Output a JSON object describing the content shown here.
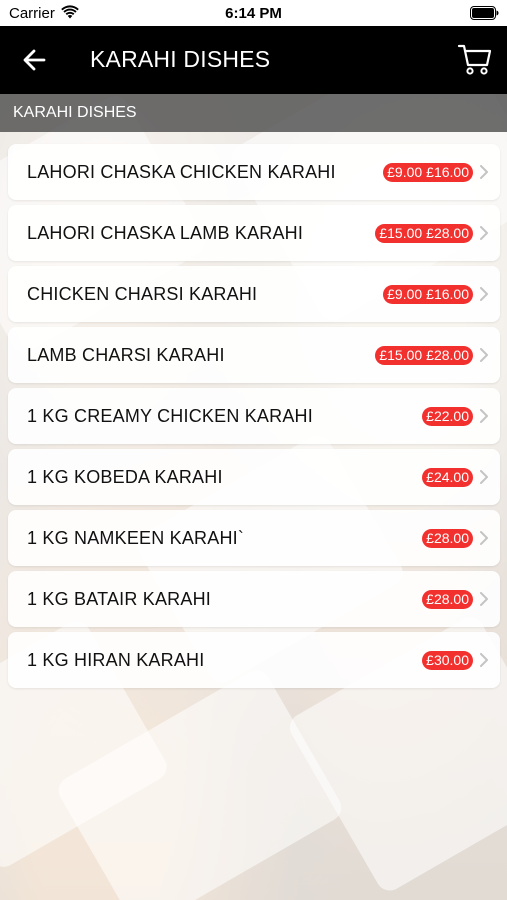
{
  "status_bar": {
    "carrier": "Carrier",
    "time": "6:14 PM"
  },
  "nav": {
    "title": "KARAHI DISHES"
  },
  "section": {
    "header": "KARAHI DISHES"
  },
  "items": [
    {
      "name": "LAHORI CHASKA CHICKEN KARAHI",
      "prices": [
        "£9.00",
        "£16.00"
      ]
    },
    {
      "name": "LAHORI CHASKA LAMB KARAHI",
      "prices": [
        "£15.00",
        "£28.00"
      ]
    },
    {
      "name": "CHICKEN CHARSI KARAHI",
      "prices": [
        "£9.00",
        "£16.00"
      ]
    },
    {
      "name": "LAMB CHARSI KARAHI",
      "prices": [
        "£15.00",
        "£28.00"
      ]
    },
    {
      "name": "1 KG CREAMY CHICKEN KARAHI",
      "prices": [
        "£22.00"
      ]
    },
    {
      "name": "1 KG KOBEDA KARAHI",
      "prices": [
        "£24.00"
      ]
    },
    {
      "name": "1 KG NAMKEEN KARAHI`",
      "prices": [
        "£28.00"
      ]
    },
    {
      "name": "1 KG BATAIR KARAHI",
      "prices": [
        "£28.00"
      ]
    },
    {
      "name": "1 KG HIRAN KARAHI",
      "prices": [
        "£30.00"
      ]
    }
  ],
  "colors": {
    "nav_bg": "#000000",
    "price_badge": "#f2302e",
    "section_header_bg": "#464646"
  },
  "icons": {
    "back": "arrow-left-icon",
    "cart": "shopping-cart-icon",
    "row": "chevron-right-icon"
  }
}
